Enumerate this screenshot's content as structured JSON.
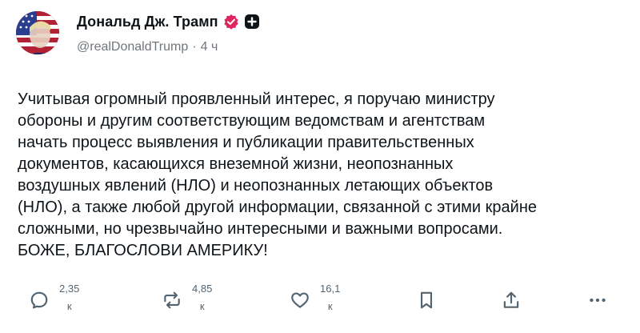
{
  "author": {
    "display_name": "Дональд Дж. Трамп",
    "handle": "@realDonaldTrump",
    "separator": "·",
    "time": "4 ч"
  },
  "post": {
    "lines": [
      "Учитывая огромный проявленный интерес, я поручаю министру",
      "обороны и другим соответствующим ведомствам и агентствам",
      "начать процесс выявления и публикации правительственных",
      "документов, касающихся внеземной жизни, неопознанных",
      "воздушных явлений (НЛО) и неопознанных летающих объектов",
      "(НЛО), а также любой другой информации, связанной с этими крайне",
      "сложными, но чрезвычайно интересными и важными вопросами.",
      "БОЖЕ, БЛАГОСЛОВИ АМЕРИКУ!"
    ]
  },
  "actions": {
    "reply": {
      "icon": "comment-icon",
      "count": "2,35",
      "unit": "к"
    },
    "repost": {
      "icon": "repost-icon",
      "count": "4,85",
      "unit": "к"
    },
    "like": {
      "icon": "heart-icon",
      "count": "16,1",
      "unit": "к"
    },
    "bookmark": {
      "icon": "bookmark-icon"
    },
    "share": {
      "icon": "share-icon"
    },
    "more": {
      "icon": "more-icon"
    }
  },
  "colors": {
    "verified_badge": "#e0245e",
    "icon_gray": "#536471",
    "text": "#0f1419"
  }
}
